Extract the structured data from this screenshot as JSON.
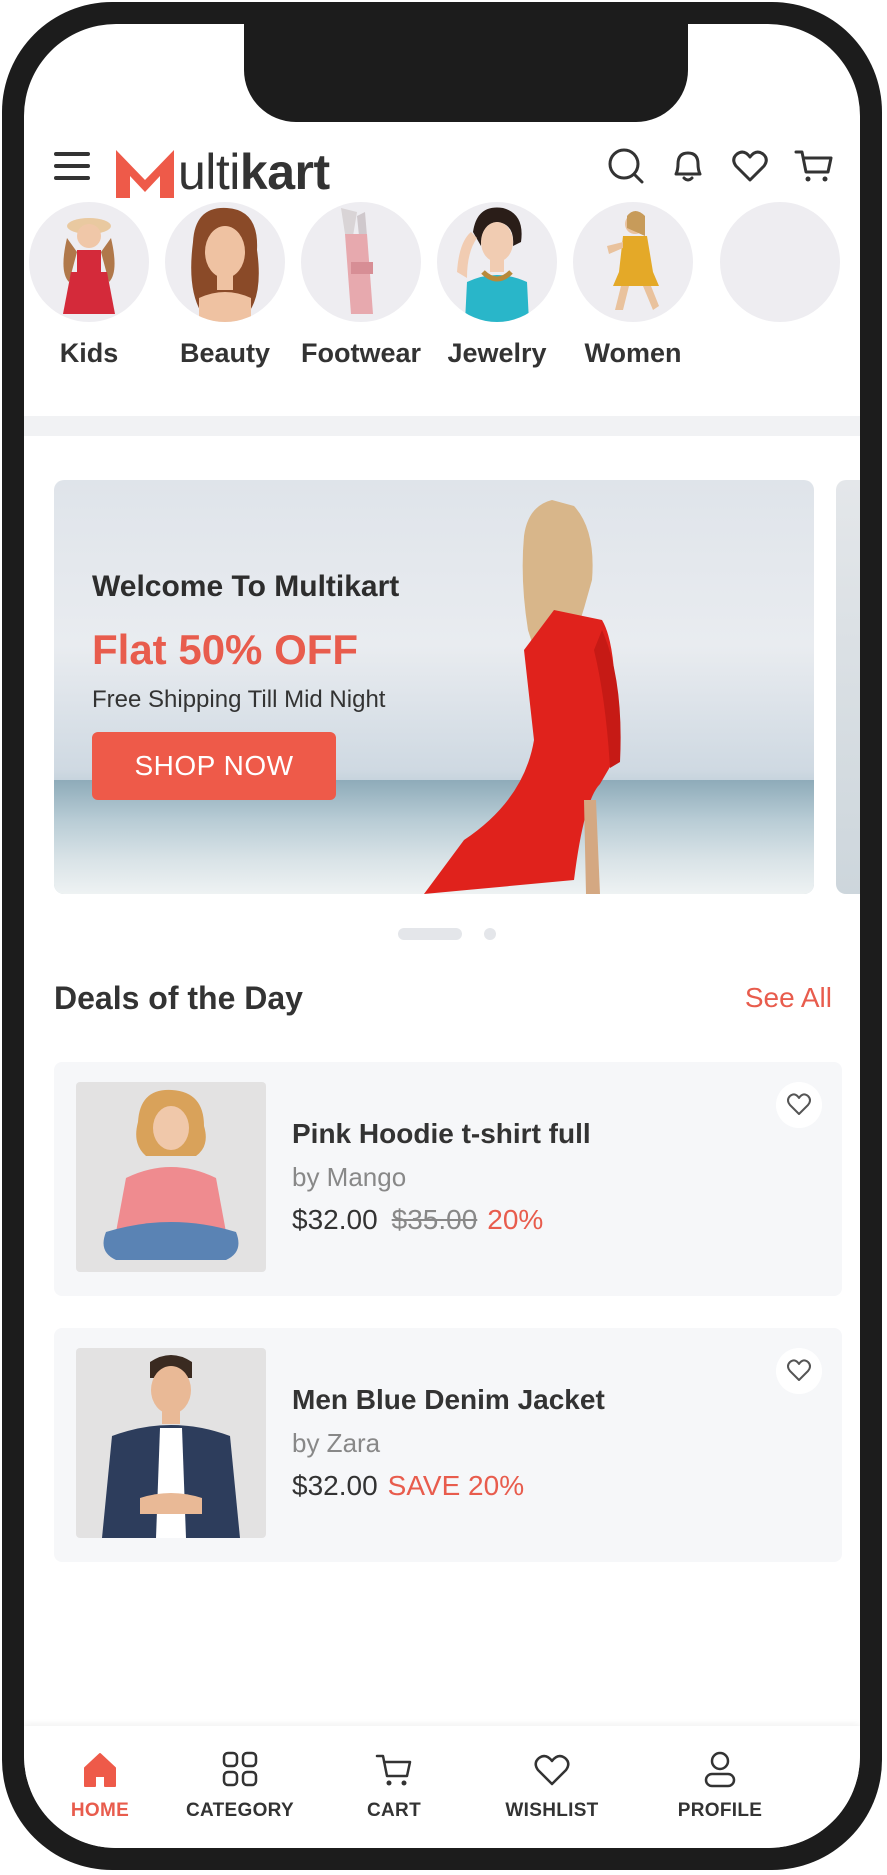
{
  "brand": {
    "logo_text_light": "ulti",
    "logo_text_bold": "kart",
    "accent": "#ee5a49"
  },
  "header": {
    "icons": [
      "menu-icon",
      "search-icon",
      "bell-icon",
      "heart-icon",
      "cart-icon"
    ]
  },
  "categories": [
    {
      "label": "Kids"
    },
    {
      "label": "Beauty"
    },
    {
      "label": "Footwear"
    },
    {
      "label": "Jewelry"
    },
    {
      "label": "Women"
    }
  ],
  "banner": {
    "title": "Welcome To Multikart",
    "offer": "Flat 50% OFF",
    "subtitle": "Free Shipping Till Mid Night",
    "button": "SHOP NOW",
    "slides_active": 1,
    "slides_total": 2
  },
  "deals": {
    "title": "Deals of the Day",
    "see_all": "See All",
    "items": [
      {
        "name": "Pink Hoodie t-shirt full",
        "brand": "by Mango",
        "price": "$32.00",
        "old_price": "$35.00",
        "discount": "20%"
      },
      {
        "name": "Men Blue Denim Jacket",
        "brand": "by Zara",
        "price": "$32.00",
        "old_price": "",
        "discount": "SAVE 20%"
      }
    ]
  },
  "bottom_nav": [
    {
      "label": "HOME",
      "icon": "home-icon",
      "active": true
    },
    {
      "label": "CATEGORY",
      "icon": "grid-icon",
      "active": false
    },
    {
      "label": "CART",
      "icon": "cart-icon",
      "active": false
    },
    {
      "label": "WISHLIST",
      "icon": "heart-icon",
      "active": false
    },
    {
      "label": "PROFILE",
      "icon": "user-icon",
      "active": false
    }
  ]
}
